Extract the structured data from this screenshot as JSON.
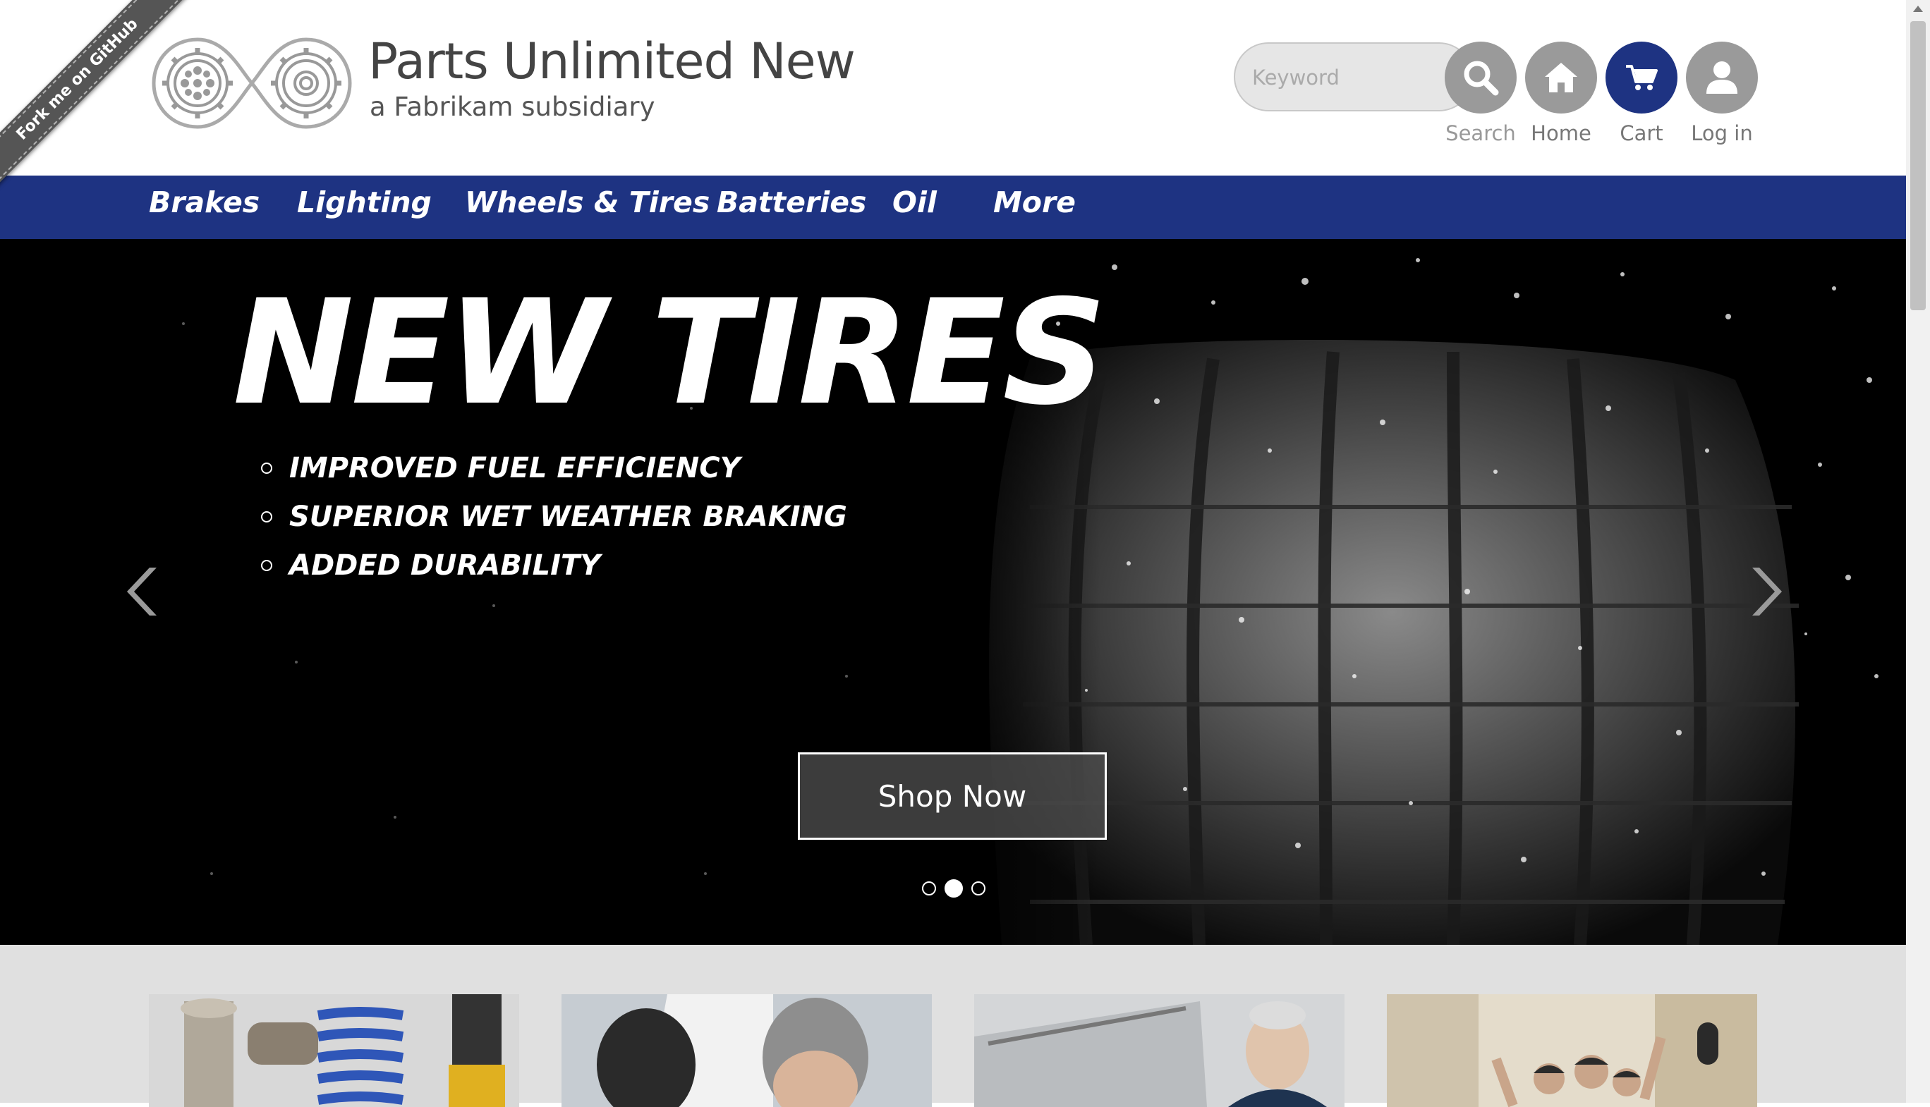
{
  "ribbon": {
    "label": "Fork me on GitHub"
  },
  "brand": {
    "title": "Parts Unlimited New",
    "subtitle": "a Fabrikam subsidiary"
  },
  "header": {
    "search": {
      "placeholder": "Keyword",
      "button_label": "Search"
    },
    "home_label": "Home",
    "cart_label": "Cart",
    "login_label": "Log in"
  },
  "nav": {
    "items": [
      {
        "label": "Brakes"
      },
      {
        "label": "Lighting"
      },
      {
        "label": "Wheels & Tires"
      },
      {
        "label": "Batteries"
      },
      {
        "label": "Oil"
      },
      {
        "label": "More"
      }
    ]
  },
  "hero": {
    "title": "NEW TIRES",
    "bullets": [
      "IMPROVED FUEL EFFICIENCY",
      "SUPERIOR WET WEATHER BRAKING",
      "ADDED DURABILITY"
    ],
    "cta": "Shop Now",
    "slide_count": 3,
    "active_slide": 2
  },
  "colors": {
    "nav_bg": "#1e3382",
    "cart_accent": "#1e3382",
    "icon_grey": "#999999"
  }
}
